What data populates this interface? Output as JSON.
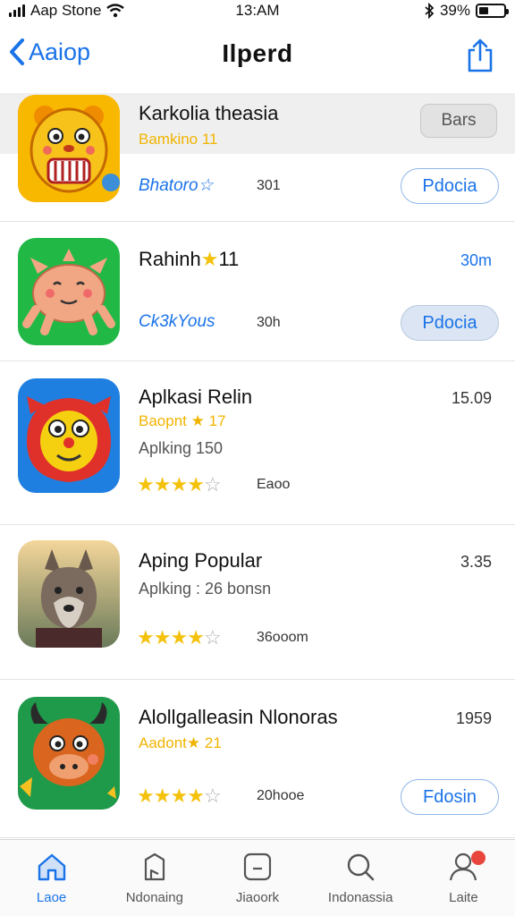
{
  "status_bar": {
    "carrier": "Aap Stone",
    "time": "13:AM",
    "battery": "39%",
    "battery_level": 0.39
  },
  "nav": {
    "back_label": "Aaiop",
    "title": "Ilperd"
  },
  "apps": [
    {
      "name": "Karkolia theasia",
      "subtitle": "Bamkino 11",
      "category": "Bhatoro",
      "meta": "301",
      "side_button": "Bars",
      "get_label": "Pdocia",
      "highlighted": true
    },
    {
      "name": "Rahinh",
      "name_suffix": "11",
      "size": "30m",
      "category": "Ck3kYous",
      "meta": "30h",
      "get_label": "Pdocia"
    },
    {
      "name": "Aplkasi Relin",
      "subtitle": "Baopnt",
      "subtitle_suffix": "17",
      "developer": "Aplking 150",
      "size": "15.09",
      "rating": 4,
      "meta": "Eaoo"
    },
    {
      "name": "Aping Popular",
      "developer": "Aplking : 26 bonsn",
      "size": "3.35",
      "rating": 4,
      "meta": "36ooom"
    },
    {
      "name": "Alollgalleasin Nlonoras",
      "subtitle": "Aadont",
      "subtitle_suffix": "21",
      "size": "1959",
      "rating": 4,
      "meta": "20hooe",
      "get_label": "Fdosin"
    }
  ],
  "tabs": [
    {
      "label": "Laoe",
      "icon": "home-icon",
      "active": true
    },
    {
      "label": "Ndonaing",
      "icon": "apps-icon",
      "active": false
    },
    {
      "label": "Jiaoork",
      "icon": "square-icon",
      "active": false
    },
    {
      "label": "Indonassia",
      "icon": "search-icon",
      "active": false
    },
    {
      "label": "Laite",
      "icon": "profile-icon",
      "active": false,
      "badge": true
    }
  ],
  "colors": {
    "accent": "#1a73e8",
    "star": "#f4c20d",
    "subtitle_yellow": "#f0b400",
    "badge": "#e8453c"
  }
}
